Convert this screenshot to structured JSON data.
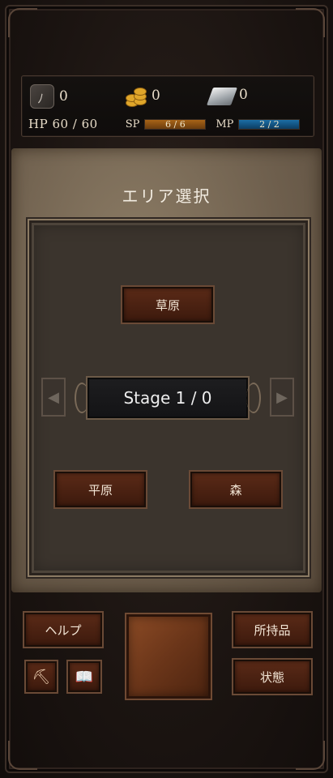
{
  "resources": {
    "claw": {
      "icon": "claw-icon",
      "value": "0"
    },
    "gold": {
      "icon": "gold-coins-icon",
      "value": "0"
    },
    "ingot": {
      "icon": "silver-ingot-icon",
      "value": "0"
    }
  },
  "stats": {
    "hp_text": "HP 60 / 60",
    "sp_label": "SP",
    "sp_value": "6 / 6",
    "mp_label": "MP",
    "mp_value": "2 / 2"
  },
  "area": {
    "title": "エリア選択",
    "top_button": "草原",
    "stage_text": "Stage 1 / 0",
    "left_button": "平原",
    "right_button": "森",
    "prev_arrow": "◀",
    "next_arrow": "▶"
  },
  "bottom": {
    "help": "ヘルプ",
    "items": "所持品",
    "status": "状態",
    "small1_icon": "pickaxe-icon",
    "small2_icon": "book-icon"
  },
  "colors": {
    "button_bg": "#4a2211",
    "sp_bar": "#a86417",
    "mp_bar": "#1b6ea6",
    "parchment": "#7a6a55"
  }
}
